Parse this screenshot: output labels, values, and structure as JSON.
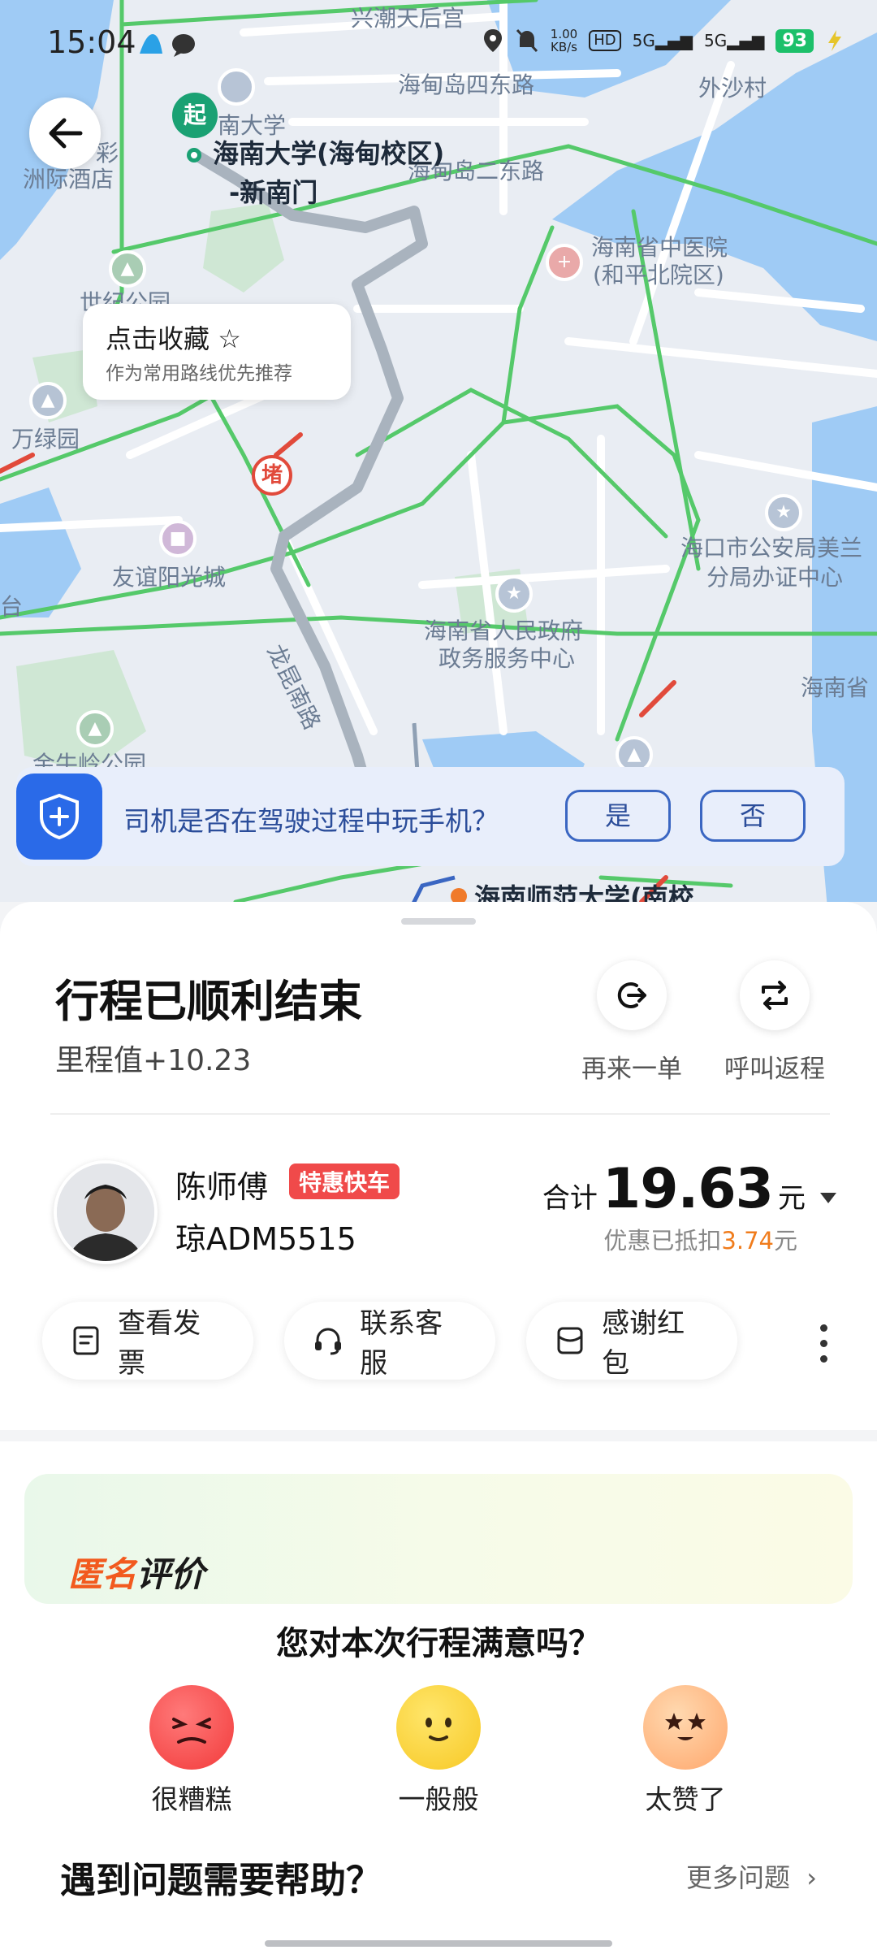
{
  "status_bar": {
    "time": "15:04",
    "net_speed_value": "1.00",
    "net_speed_unit": "KB/s",
    "hd": "HD",
    "sim1": "5G",
    "sim2": "5G",
    "battery": "93"
  },
  "map": {
    "labels": {
      "xingchao": "兴潮天后宫",
      "haidian4": "海甸岛四东路",
      "waishacun": "外沙村",
      "hainan_univ_short": "南大学",
      "haidian2": "海甸岛二东路",
      "hotel_line1": "彩",
      "hotel_line2": "洲际酒店",
      "tcm_line1": "海南省中医院",
      "tcm_line2": "(和平北院区)",
      "park": "世纪公园",
      "wanlv": "万绿园",
      "youyi": "友谊阳光城",
      "police_line1": "海口市公安局美兰",
      "police_line2": "分局办证中心",
      "gov_line1": "海南省人民政府",
      "gov_line2": "政务服务中心",
      "longkun": "龙昆南路",
      "hainan_prov": "海南省",
      "jinniu": "金牛岭公园",
      "tai": "台",
      "destination": "海南师范大学(南校"
    },
    "start_pin": "起",
    "start_name_line1": "海南大学(海甸校区)",
    "start_name_line2": "-新南门",
    "jam": "堵",
    "favorite": {
      "title": "点击收藏",
      "subtitle": "作为常用路线优先推荐"
    },
    "question": {
      "text": "司机是否在驾驶过程中玩手机？",
      "yes": "是",
      "no": "否"
    }
  },
  "trip": {
    "title": "行程已顺利结束",
    "mileage": "里程值+10.23",
    "actions": {
      "again": "再来一单",
      "return": "呼叫返程"
    }
  },
  "driver": {
    "name": "陈师傅",
    "service": "特惠快车",
    "plate": "琼ADM5515"
  },
  "fare": {
    "prefix": "合计",
    "amount": "19.63",
    "unit": "元",
    "discount_prefix": "优惠已抵扣",
    "discount_amount": "3.74",
    "discount_unit": "元"
  },
  "buttons": {
    "invoice": "查看发票",
    "service": "联系客服",
    "tip": "感谢红包"
  },
  "rating": {
    "tag_part1": "匿名",
    "tag_part2": "评价",
    "question": "您对本次行程满意吗？",
    "options": [
      "很糟糕",
      "一般般",
      "太赞了"
    ]
  },
  "help": {
    "title": "遇到问题需要帮助？",
    "more": "更多问题"
  },
  "colors": {
    "accent_blue": "#2a6ae8",
    "start_green": "#1aa173",
    "badge_red": "#f04a4a",
    "discount_orange": "#f07c1c"
  }
}
